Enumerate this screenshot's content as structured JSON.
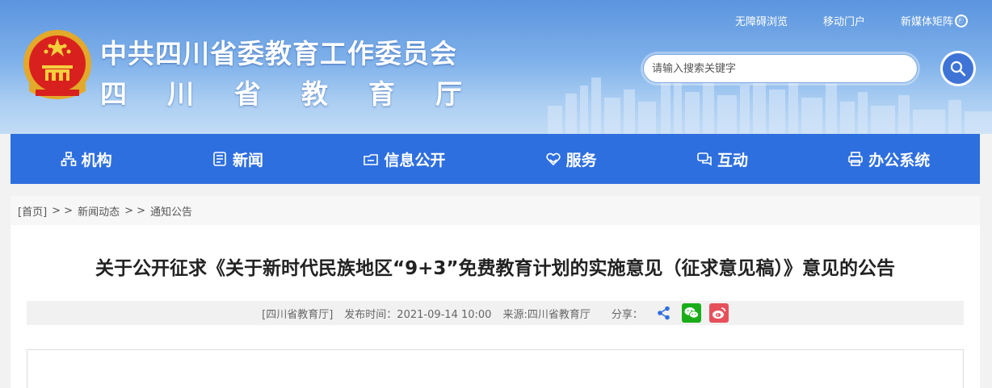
{
  "header": {
    "title": "中共四川省委教育工作委员会",
    "subtitle_chars": [
      "四",
      "川",
      "省",
      "教",
      "育",
      "厅"
    ],
    "top_links": [
      {
        "label": "无障碍浏览"
      },
      {
        "label": "移动门户"
      },
      {
        "label": "新媒体矩阵"
      }
    ],
    "search": {
      "placeholder": "请输入搜索关键字"
    }
  },
  "nav": {
    "items": [
      {
        "label": "机构",
        "icon": "org-icon"
      },
      {
        "label": "新闻",
        "icon": "news-icon"
      },
      {
        "label": "信息公开",
        "icon": "info-open-icon"
      },
      {
        "label": "服务",
        "icon": "service-icon"
      },
      {
        "label": "互动",
        "icon": "interact-icon"
      },
      {
        "label": "办公系统",
        "icon": "office-icon"
      }
    ]
  },
  "breadcrumb": {
    "home": "[首页]",
    "separator": "> >",
    "items": [
      "新闻动态",
      "通知公告"
    ]
  },
  "article": {
    "title": "关于公开征求《关于新时代民族地区“9+3”免费教育计划的实施意见（征求意见稿）》意见的公告",
    "meta": {
      "publisher": "[四川省教育厅]",
      "publish_time": "发布时间：2021-09-14 10:00",
      "source": "来源:四川省教育厅",
      "share_label": "分享："
    }
  },
  "colors": {
    "nav_bg": "#2e6fe0",
    "share_generic": "#2e6fe0",
    "share_wechat": "#1aad19",
    "share_weibo": "#e6505a"
  }
}
